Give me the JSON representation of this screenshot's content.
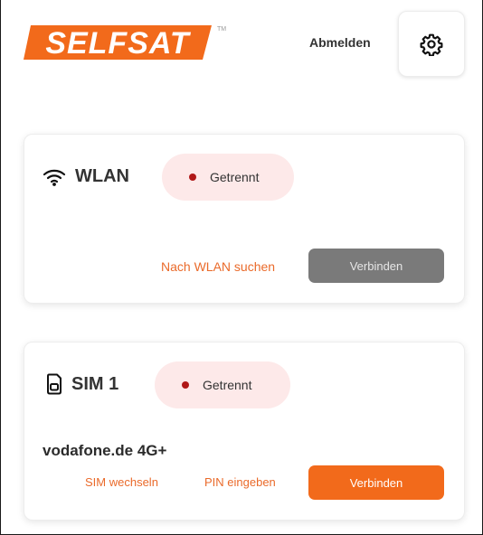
{
  "header": {
    "logo_text": "SELFSAT",
    "logo_tm": "TM",
    "logout_label": "Abmelden",
    "settings_icon": "gear-icon"
  },
  "wlan": {
    "title": "WLAN",
    "icon": "wifi-icon",
    "status": "Getrennt",
    "search_label": "Nach WLAN suchen",
    "connect_label": "Verbinden"
  },
  "sim": {
    "title": "SIM 1",
    "icon": "sim-card-icon",
    "status": "Getrennt",
    "operator": "vodafone.de 4G+",
    "switch_label": "SIM wechseln",
    "pin_label": "PIN eingeben",
    "connect_label": "Verbinden"
  },
  "colors": {
    "brand": "#f26a1b",
    "status_disconnected": "#b01818",
    "status_bg": "#fde9e9",
    "disabled_button": "#7a7a7a"
  }
}
